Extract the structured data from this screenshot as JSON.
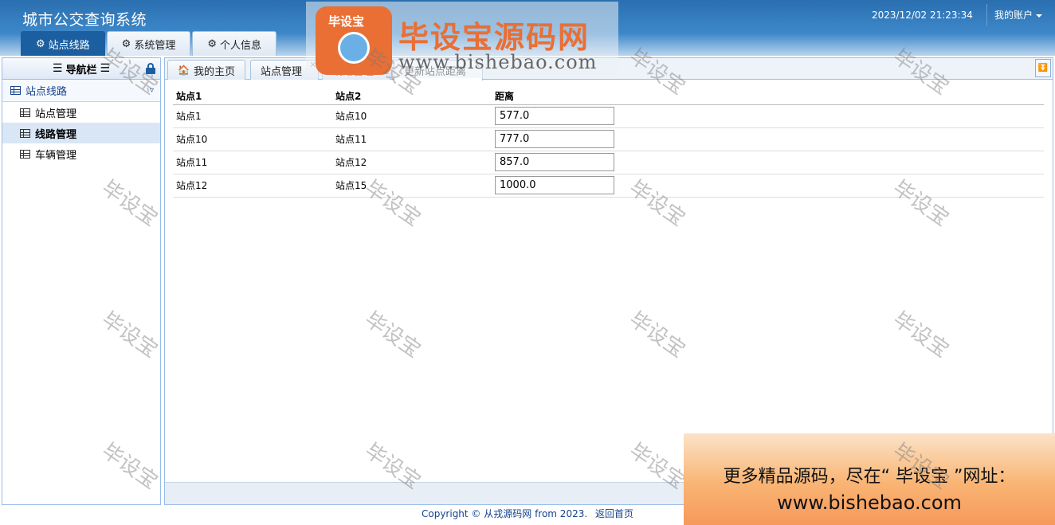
{
  "header": {
    "title": "城市公交查询系统",
    "clock": "2023/12/02 21:23:34",
    "account": "我的账户",
    "tabs": [
      {
        "label": "站点线路"
      },
      {
        "label": "系统管理"
      },
      {
        "label": "个人信息"
      }
    ]
  },
  "sidebar": {
    "title": "导航栏",
    "group": "站点线路",
    "items": [
      {
        "label": "站点管理"
      },
      {
        "label": "线路管理"
      },
      {
        "label": "车辆管理"
      }
    ]
  },
  "content_tabs": [
    {
      "label": "我的主页"
    },
    {
      "label": "站点管理"
    },
    {
      "label": "线路管理"
    },
    {
      "label": "更新站点距离"
    }
  ],
  "table": {
    "headers": [
      "站点1",
      "站点2",
      "距离"
    ],
    "rows": [
      {
        "s1": "站点1",
        "s2": "站点10",
        "dist": "577.0"
      },
      {
        "s1": "站点10",
        "s2": "站点11",
        "dist": "777.0"
      },
      {
        "s1": "站点11",
        "s2": "站点12",
        "dist": "857.0"
      },
      {
        "s1": "站点12",
        "s2": "站点15",
        "dist": "1000.0"
      }
    ]
  },
  "footer": {
    "copyright": "Copyright © 从戎源码网 from 2023.",
    "home_link": "返回首页"
  },
  "watermark": {
    "text": "毕设宝",
    "logo_name": "毕设宝源码网",
    "logo_url": "www.bishebao.com",
    "badge": "毕设宝"
  },
  "promo": {
    "line1": "更多精品源码，尽在“ 毕设宝 ”网址：",
    "line2": "www.bishebao.com"
  },
  "colors": {
    "accent": "#1c5fa1",
    "border": "#99bbe8",
    "link": "#15428b",
    "brand_orange": "#e96f35"
  }
}
